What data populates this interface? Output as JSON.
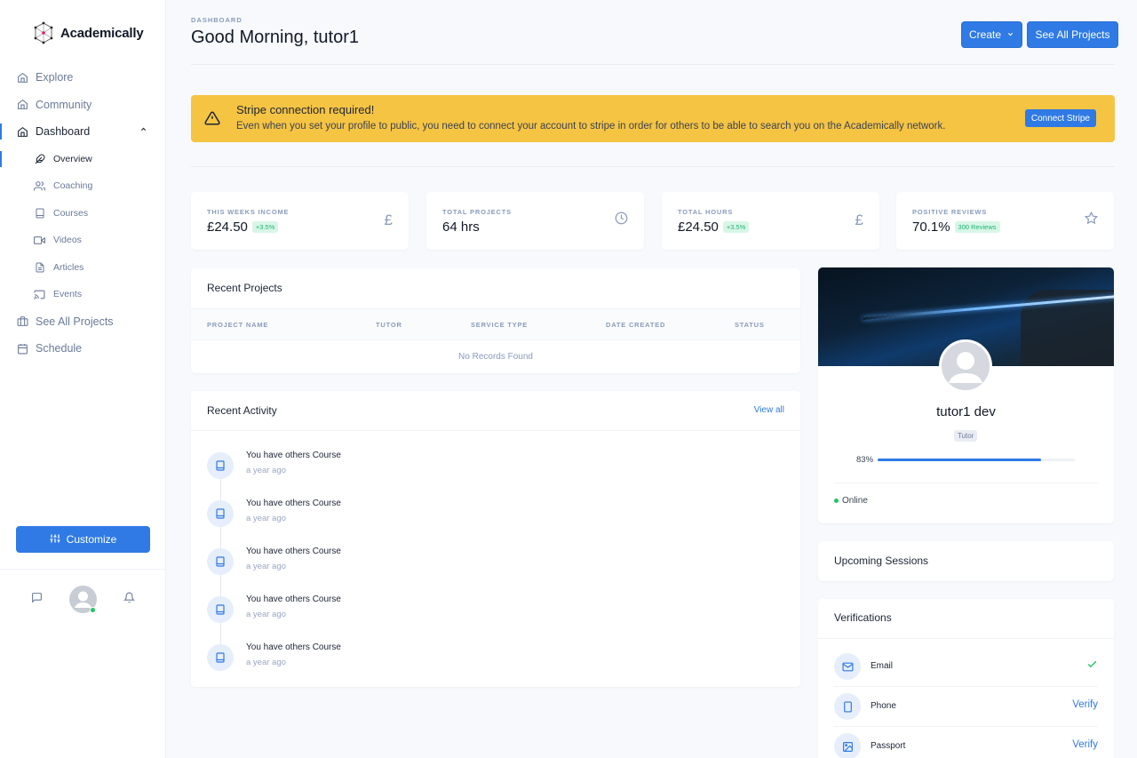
{
  "app": {
    "name": "Academically"
  },
  "sidebar": {
    "items": [
      {
        "label": "Explore",
        "icon": "home-icon"
      },
      {
        "label": "Community",
        "icon": "home-icon"
      },
      {
        "label": "Dashboard",
        "icon": "home-icon",
        "expanded": true
      }
    ],
    "sub_items": [
      {
        "label": "Overview",
        "icon": "feather-icon",
        "active": true
      },
      {
        "label": "Coaching",
        "icon": "users-icon"
      },
      {
        "label": "Courses",
        "icon": "book-icon"
      },
      {
        "label": "Videos",
        "icon": "video-icon"
      },
      {
        "label": "Articles",
        "icon": "file-text-icon"
      },
      {
        "label": "Events",
        "icon": "cast-icon"
      }
    ],
    "bottom_items": [
      {
        "label": "See All Projects",
        "icon": "briefcase-icon"
      },
      {
        "label": "Schedule",
        "icon": "calendar-icon"
      }
    ],
    "customize_label": "Customize",
    "user_status": "online"
  },
  "header": {
    "breadcrumb": "DASHBOARD",
    "title": "Good Morning, tutor1",
    "create_label": "Create",
    "see_all_label": "See All Projects"
  },
  "alert": {
    "title": "Stripe connection required!",
    "text": "Even when you set your profile to public, you need to connect your account to stripe in order for others to be able to search you on the Academically network.",
    "button_label": "Connect Stripe",
    "color": "#f5c443"
  },
  "stats": [
    {
      "label": "THIS WEEKS INCOME",
      "value": "£24.50",
      "badge": "+3.5%",
      "icon": "pound-icon"
    },
    {
      "label": "TOTAL PROJECTS",
      "value": "64 hrs",
      "badge": null,
      "icon": "clock-icon"
    },
    {
      "label": "TOTAL HOURS",
      "value": "£24.50",
      "badge": "+3.5%",
      "icon": "pound-icon"
    },
    {
      "label": "POSITIVE REVIEWS",
      "value": "70.1%",
      "badge": "300 Reviews",
      "icon": "star-icon"
    }
  ],
  "recent_projects": {
    "title": "Recent Projects",
    "columns": [
      "PROJECT NAME",
      "TUTOR",
      "SERVICE TYPE",
      "DATE CREATED",
      "STATUS"
    ],
    "empty_text": "No Records Found"
  },
  "recent_activity": {
    "title": "Recent Activity",
    "view_all_label": "View all",
    "items": [
      {
        "text": "You have others Course",
        "time": "a year ago"
      },
      {
        "text": "You have others Course",
        "time": "a year ago"
      },
      {
        "text": "You have others Course",
        "time": "a year ago"
      },
      {
        "text": "You have others Course",
        "time": "a year ago"
      },
      {
        "text": "You have others Course",
        "time": "a year ago"
      }
    ]
  },
  "profile": {
    "name": "tutor1 dev",
    "role": "Tutor",
    "completion_percent": 83,
    "completion_label": "83%",
    "status": "Online"
  },
  "upcoming_sessions": {
    "title": "Upcoming Sessions"
  },
  "verifications": {
    "title": "Verifications",
    "items": [
      {
        "label": "Email",
        "verified": true,
        "action": "",
        "icon": "mail-icon"
      },
      {
        "label": "Phone",
        "verified": false,
        "action": "Verify",
        "icon": "phone-icon"
      },
      {
        "label": "Passport",
        "verified": false,
        "action": "Verify",
        "icon": "image-icon"
      }
    ]
  },
  "colors": {
    "accent": "#2f7ae5",
    "success": "#22c55e",
    "warning": "#f5c443"
  }
}
